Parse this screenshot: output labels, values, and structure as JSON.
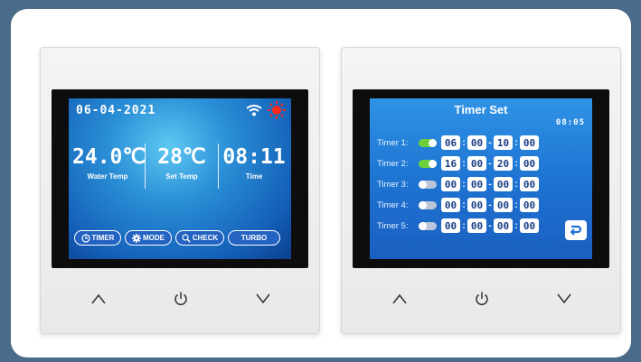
{
  "home": {
    "date": "06-04-2021",
    "icons": [
      "wifi-icon",
      "sun-icon"
    ],
    "water_temp": {
      "value": "24.0℃",
      "label": "Water Temp"
    },
    "set_temp": {
      "value": "28℃",
      "label": "Set Temp"
    },
    "time": {
      "value": "08:11",
      "label": "Time"
    },
    "buttons": [
      {
        "label": "TIMER",
        "icon": "clock-icon"
      },
      {
        "label": "MODE",
        "icon": "gear-icon"
      },
      {
        "label": "CHECK",
        "icon": "search-icon"
      },
      {
        "label": "TURBO",
        "icon": ""
      }
    ]
  },
  "timer": {
    "title": "Timer Set",
    "clock": "08:05",
    "rows": [
      {
        "label": "Timer 1:",
        "enabled": true,
        "values": [
          "06",
          "00",
          "10",
          "00"
        ]
      },
      {
        "label": "Timer 2:",
        "enabled": true,
        "values": [
          "16",
          "00",
          "20",
          "00"
        ]
      },
      {
        "label": "Timer 3:",
        "enabled": false,
        "values": [
          "00",
          "00",
          "00",
          "00"
        ]
      },
      {
        "label": "Timer 4:",
        "enabled": false,
        "values": [
          "00",
          "00",
          "00",
          "00"
        ]
      },
      {
        "label": "Timer 5:",
        "enabled": false,
        "values": [
          "00",
          "00",
          "00",
          "00"
        ]
      }
    ],
    "separators": [
      ":",
      "-",
      ":"
    ],
    "back_icon": "return-icon"
  },
  "hardware_buttons": [
    "up-arrow-icon",
    "power-icon",
    "down-arrow-icon"
  ],
  "colors": {
    "toggle_on": "#6ccf3c",
    "toggle_off": "#b9c6d8",
    "button_fill": "#2463c2",
    "background": "#4a6b8a"
  }
}
